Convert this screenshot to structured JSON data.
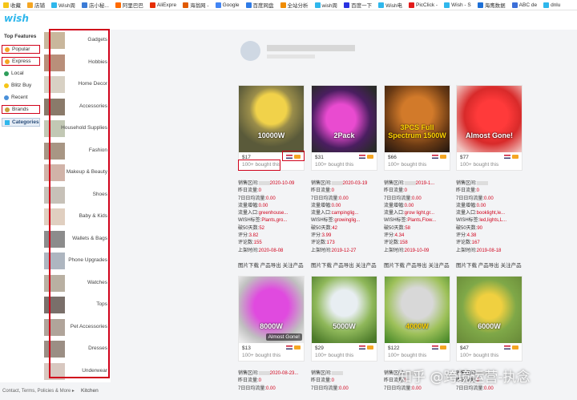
{
  "bookmarks": [
    {
      "label": "收藏",
      "color": "#f5c518"
    },
    {
      "label": "店铺",
      "color": "#f5a623"
    },
    {
      "label": "Wish周",
      "color": "#2fb7ec"
    },
    {
      "label": "店小秘...",
      "color": "#3b7bd6"
    },
    {
      "label": "阿里巴巴",
      "color": "#ff6a00"
    },
    {
      "label": "AliExpre",
      "color": "#e62e04"
    },
    {
      "label": "海翁网 -",
      "color": "#e05a00"
    },
    {
      "label": "Google",
      "color": "#4285f4"
    },
    {
      "label": "百度网盘",
      "color": "#2f7be6"
    },
    {
      "label": "全站分析",
      "color": "#f08c00"
    },
    {
      "label": "wish周",
      "color": "#2fb7ec"
    },
    {
      "label": "百度一下",
      "color": "#2932e1"
    },
    {
      "label": "Wish电",
      "color": "#2fb7ec"
    },
    {
      "label": "PicClick -",
      "color": "#e21b1b"
    },
    {
      "label": "Wish - S",
      "color": "#2fb7ec"
    },
    {
      "label": "海鹰数据",
      "color": "#1d6fd6"
    },
    {
      "label": "ABC de",
      "color": "#3c6fd8"
    },
    {
      "label": "dnlu",
      "color": "#2fb7ec"
    }
  ],
  "logo": "wish",
  "sidebar": {
    "title": "Top Features",
    "items": [
      {
        "label": "Popular",
        "color": "#f5a623"
      },
      {
        "label": "Express",
        "color": "#f5a623"
      },
      {
        "label": "Local",
        "color": "#2e9e5b"
      },
      {
        "label": "Blitz Buy",
        "color": "#f5c518"
      },
      {
        "label": "Recent",
        "color": "#4a90d9"
      },
      {
        "label": "Brands",
        "color": "#c9a13b"
      }
    ],
    "categories_label": "Categories"
  },
  "categories": [
    "Gadgets",
    "Hobbies",
    "Home Decor",
    "Accessories",
    "Household Supplies",
    "Fashion",
    "Makeup & Beauty",
    "Shoes",
    "Baby & Kids",
    "Wallets & Bags",
    "Phone Upgrades",
    "Watches",
    "Tops",
    "Pet Accessories",
    "Dresses",
    "Underwear"
  ],
  "footer": {
    "links": "Contact, Terms, Policies & More ▸",
    "extra_category": "Kitchen"
  },
  "products_row1": [
    {
      "price": "$17",
      "bought": "100+ bought this",
      "overlay": "10000W"
    },
    {
      "price": "$31",
      "bought": "100+ bought this",
      "overlay": "2Pack"
    },
    {
      "price": "$66",
      "bought": "100+ bought this",
      "overlay": "3PCS Full Spectrum 1500W"
    },
    {
      "price": "$77",
      "bought": "100+ bought this",
      "overlay": "Almost Gone!"
    }
  ],
  "products_row2": [
    {
      "price": "$13",
      "bought": "100+ bought this",
      "overlay": "8000W",
      "badge": "Almost Gone!"
    },
    {
      "price": "$29",
      "bought": "100+ bought this",
      "overlay": "5000W"
    },
    {
      "price": "$122",
      "bought": "100+ bought this",
      "overlay": "4000W"
    },
    {
      "price": "$47",
      "bought": "100+ bought this",
      "overlay": "6000W"
    }
  ],
  "stat_labels": [
    "销售区间:",
    "昨日流量:",
    "7日日均流量:",
    "流量增幅:",
    "流量入口:",
    "WISH标签:",
    "破50天数:",
    "评分:",
    "评论数:",
    "上架时间:"
  ],
  "stats": [
    {
      "range": "",
      "yesterday": "0",
      "avg7": "0.00",
      "growth": "0.00",
      "entry": "greenhouse...",
      "tags": "Plants,gro...",
      "days50": "52",
      "rating": "3.82",
      "reviews": "155",
      "listed": "2020-08-08",
      "range_tail": "2020-10-09"
    },
    {
      "range": "",
      "yesterday": "0",
      "avg7": "0.00",
      "growth": "0.00",
      "entry": "campinglig...",
      "tags": "growinglig...",
      "days50": "42",
      "rating": "3.99",
      "reviews": "173",
      "listed": "2019-12-27",
      "range_tail": "2020-03-19"
    },
    {
      "range": "",
      "yesterday": "0",
      "avg7": "0.00",
      "growth": "0.00",
      "entry": "grow light,gr...",
      "tags": "Plants,Flow...",
      "days50": "58",
      "rating": "4.34",
      "reviews": "158",
      "listed": "2019-10-09",
      "range_tail": "2019-1..."
    },
    {
      "range": "",
      "yesterday": "0",
      "avg7": "0.00",
      "growth": "0.00",
      "entry": "booklight,le...",
      "tags": "led,lights,L...",
      "days50": "90",
      "rating": "4.38",
      "reviews": "167",
      "listed": "2019-08-18",
      "range_tail": ""
    }
  ],
  "actions": "图片下载 产品导出 关注产品",
  "stats_row2_head": [
    {
      "range_tail": "2020-08-23..."
    },
    {
      "range_tail": ""
    },
    {
      "range_tail": ""
    },
    {
      "range_tail": ""
    }
  ],
  "watermark": "知乎 @跨境运营-执念"
}
